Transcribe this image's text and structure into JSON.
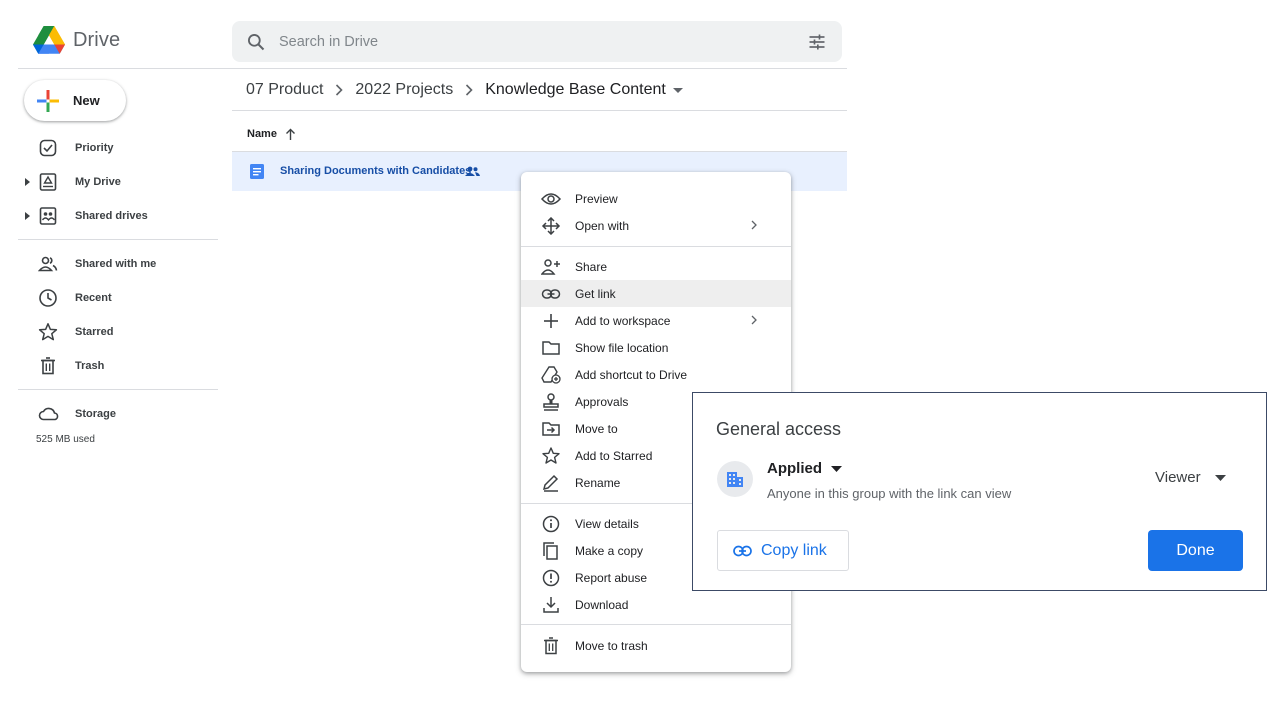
{
  "app": {
    "name": "Drive"
  },
  "search": {
    "placeholder": "Search in Drive",
    "value": ""
  },
  "new_button": {
    "label": "New"
  },
  "sidebar": {
    "items": [
      {
        "label": "Priority",
        "icon": "priority-icon"
      },
      {
        "label": "My Drive",
        "icon": "my-drive-icon"
      },
      {
        "label": "Shared drives",
        "icon": "shared-drives-icon"
      },
      {
        "label": "Shared with me",
        "icon": "people-icon"
      },
      {
        "label": "Recent",
        "icon": "clock-icon"
      },
      {
        "label": "Starred",
        "icon": "star-icon"
      },
      {
        "label": "Trash",
        "icon": "trash-icon"
      },
      {
        "label": "Storage",
        "icon": "cloud-icon"
      }
    ],
    "storage_used": "525 MB used"
  },
  "breadcrumb": [
    "07 Product",
    "2022 Projects",
    "Knowledge Base Content"
  ],
  "file_list": {
    "column_header": "Name",
    "sort": "ascending",
    "rows": [
      {
        "name": "Sharing Documents with Candidates",
        "shared": true,
        "selected": true
      }
    ]
  },
  "context_menu": {
    "items": [
      {
        "label": "Preview",
        "icon": "eye-icon"
      },
      {
        "label": "Open with",
        "icon": "open-with-icon",
        "submenu": true
      },
      {
        "label": "Share",
        "icon": "person-add-icon"
      },
      {
        "label": "Get link",
        "icon": "link-icon",
        "active": true
      },
      {
        "label": "Add to workspace",
        "icon": "plus-icon",
        "submenu": true
      },
      {
        "label": "Show file location",
        "icon": "folder-icon"
      },
      {
        "label": "Add shortcut to Drive",
        "icon": "add-shortcut-icon"
      },
      {
        "label": "Approvals",
        "icon": "approvals-icon"
      },
      {
        "label": "Move to",
        "icon": "move-to-icon"
      },
      {
        "label": "Add to Starred",
        "icon": "star-icon"
      },
      {
        "label": "Rename",
        "icon": "pencil-icon"
      },
      {
        "label": "View details",
        "icon": "info-icon"
      },
      {
        "label": "Make a copy",
        "icon": "copy-icon"
      },
      {
        "label": "Report abuse",
        "icon": "report-icon"
      },
      {
        "label": "Download",
        "icon": "download-icon"
      },
      {
        "label": "Move to trash",
        "icon": "trash-icon"
      }
    ]
  },
  "general_access": {
    "title": "General access",
    "group_name": "Applied",
    "description": "Anyone in this group with the link can view",
    "role": "Viewer",
    "copy_link_label": "Copy link",
    "done_label": "Done"
  },
  "colors": {
    "accent": "#1a73e8",
    "selected_row": "#e8f0fe",
    "file_text": "#174ea6"
  }
}
